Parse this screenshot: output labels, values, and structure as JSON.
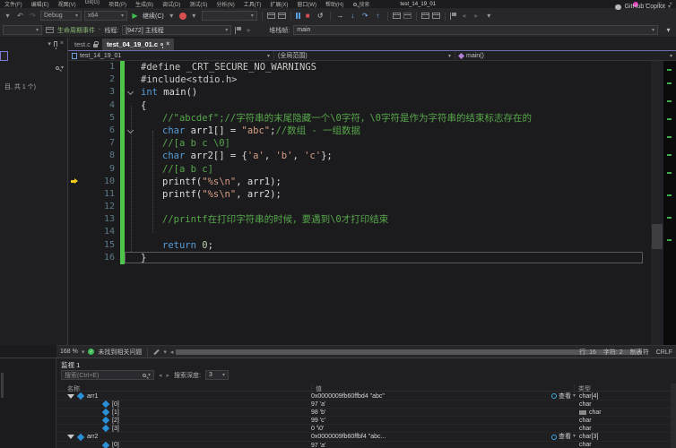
{
  "window": {
    "title": "test_14_19_01",
    "menus": [
      "文件(F)",
      "编辑(E)",
      "视图(V)",
      "Git(G)",
      "项目(P)",
      "生成(B)",
      "调试(D)",
      "测试(S)",
      "分析(N)",
      "工具(T)",
      "扩展(X)",
      "窗口(W)",
      "帮助(H)"
    ],
    "search_label": "搜索",
    "minimize_label": "—",
    "maximize_label": "□",
    "close_label": "×"
  },
  "copilot": {
    "label": "GitHub Copilot"
  },
  "toolbar": {
    "config": "Debug",
    "platform": "x64",
    "continue_label": "继续(C)"
  },
  "debug_location": {
    "lifecycle": "生命周期事件",
    "dash": "-",
    "thread_label": "线程:",
    "thread_value": "[9472] 主线程",
    "frame_label": "堆栈帧:",
    "frame_value": "main"
  },
  "left_panel": {
    "summary": "目, 共 1 个)"
  },
  "tabs": [
    {
      "label": "test.c",
      "state": "locked"
    },
    {
      "label": "test_04_19_01.c",
      "state": "active"
    }
  ],
  "navbar": {
    "project": "test_14_19_01",
    "scope": "(全局范围)",
    "member": "main()"
  },
  "editor": {
    "arrow_line": 10,
    "caret_line": 16,
    "lines": [
      {
        "n": 1,
        "i": 0,
        "s": [
          {
            "c": "pp",
            "t": "#define _CRT_SECURE_NO_WARNINGS"
          }
        ]
      },
      {
        "n": 2,
        "i": 0,
        "s": [
          {
            "c": "pp",
            "t": "#include<stdio.h>"
          }
        ]
      },
      {
        "n": 3,
        "i": 0,
        "f": true,
        "s": [
          {
            "c": "kw",
            "t": "int"
          },
          {
            "c": "pl",
            "t": " main()"
          }
        ]
      },
      {
        "n": 4,
        "i": 0,
        "s": [
          {
            "c": "pl",
            "t": "{"
          }
        ]
      },
      {
        "n": 5,
        "i": 1,
        "s": [
          {
            "c": "cmt",
            "t": "//\"abcdef\";//字符串的末尾隐藏一个\\0字符，\\0字符是作为字符串的结束标志存在的"
          }
        ]
      },
      {
        "n": 6,
        "i": 1,
        "f": true,
        "s": [
          {
            "c": "kw",
            "t": "char"
          },
          {
            "c": "pl",
            "t": " arr1[] = "
          },
          {
            "c": "str",
            "t": "\"abc\""
          },
          {
            "c": "pl",
            "t": ";"
          },
          {
            "c": "cmt",
            "t": "//数组 - 一组数据"
          }
        ]
      },
      {
        "n": 7,
        "i": 1,
        "s": [
          {
            "c": "cmt",
            "t": "//[a b c \\0]"
          }
        ]
      },
      {
        "n": 8,
        "i": 1,
        "s": [
          {
            "c": "kw",
            "t": "char"
          },
          {
            "c": "pl",
            "t": " arr2[] = {"
          },
          {
            "c": "str",
            "t": "'a'"
          },
          {
            "c": "pl",
            "t": ", "
          },
          {
            "c": "str",
            "t": "'b'"
          },
          {
            "c": "pl",
            "t": ", "
          },
          {
            "c": "str",
            "t": "'c'"
          },
          {
            "c": "pl",
            "t": "};"
          }
        ]
      },
      {
        "n": 9,
        "i": 1,
        "s": [
          {
            "c": "cmt",
            "t": "//[a b c]"
          }
        ]
      },
      {
        "n": 10,
        "i": 1,
        "s": [
          {
            "c": "pl",
            "t": "printf("
          },
          {
            "c": "str",
            "t": "\"%s\\n\""
          },
          {
            "c": "pl",
            "t": ", arr1);"
          }
        ]
      },
      {
        "n": 11,
        "i": 1,
        "s": [
          {
            "c": "pl",
            "t": "printf("
          },
          {
            "c": "str",
            "t": "\"%s\\n\""
          },
          {
            "c": "pl",
            "t": ", arr2);"
          }
        ]
      },
      {
        "n": 12,
        "i": 1,
        "s": []
      },
      {
        "n": 13,
        "i": 1,
        "s": [
          {
            "c": "cmt",
            "t": "//printf在打印字符串的时候，要遇到\\0才打印结束"
          }
        ]
      },
      {
        "n": 14,
        "i": 1,
        "s": []
      },
      {
        "n": 15,
        "i": 1,
        "s": [
          {
            "c": "kw",
            "t": "return"
          },
          {
            "c": "pl",
            "t": " "
          },
          {
            "c": "num",
            "t": "0"
          },
          {
            "c": "pl",
            "t": ";"
          }
        ]
      },
      {
        "n": 16,
        "i": 0,
        "s": [
          {
            "c": "pl",
            "t": "}"
          }
        ]
      }
    ]
  },
  "editor_status": {
    "zoom": "168 %",
    "health": "未找到相关问题",
    "line": "行: 16",
    "col": "字符: 2",
    "tabs": "制表符",
    "eol": "CRLF"
  },
  "watch": {
    "tab": "监视 1",
    "search_placeholder": "搜索(Ctrl+E)",
    "depth_label": "搜索深度:",
    "depth_value": "3",
    "columns": [
      "名称",
      "值",
      "类型"
    ],
    "view_label": "查看",
    "rows": [
      {
        "lvl": 0,
        "exp": true,
        "name": "arr1",
        "value": "0x0000009fb60ffbd4 \"abc\"",
        "view": true,
        "type": "char[4]"
      },
      {
        "lvl": 1,
        "name": "[0]",
        "value": "97 'a'",
        "type": "char"
      },
      {
        "lvl": 1,
        "name": "[1]",
        "value": "98 'b'",
        "type": "char",
        "cam": true
      },
      {
        "lvl": 1,
        "name": "[2]",
        "value": "99 'c'",
        "type": "char"
      },
      {
        "lvl": 1,
        "name": "[3]",
        "value": "0 '\\0'",
        "type": "char"
      },
      {
        "lvl": 0,
        "exp": true,
        "name": "arr2",
        "value": "0x0000009fb60ffbf4 \"abc...",
        "view": true,
        "type": "char[3]"
      },
      {
        "lvl": 1,
        "name": "[0]",
        "value": "97 'a'",
        "type": "char"
      }
    ]
  },
  "icons": {
    "dropdown": "▾",
    "undo": "↶",
    "redo": "↷",
    "play": "▶",
    "stop": "■",
    "restart": "↺",
    "show_next": "→",
    "step_into": "↓",
    "step_over": "↷",
    "step_out": "↑",
    "close": "×",
    "check": "✓",
    "back": "◂",
    "forward": "▸",
    "plus": "+",
    "pipe": "|"
  },
  "colors": {
    "kw": "#569cd6",
    "str": "#d69d85",
    "cmt": "#57a64a",
    "num": "#b5cea8",
    "pl": "#dcdcdc",
    "pp": "#c8c8c8",
    "green_bar": "#4ec44b",
    "arrow_yellow": "#f0c818",
    "status_green": "#3fba54",
    "avatar_pink": "#e23dbc",
    "hot_reload_red": "#d94f4f",
    "play_green": "#3fbf4e",
    "accent_purple": "#6e6eb4"
  }
}
